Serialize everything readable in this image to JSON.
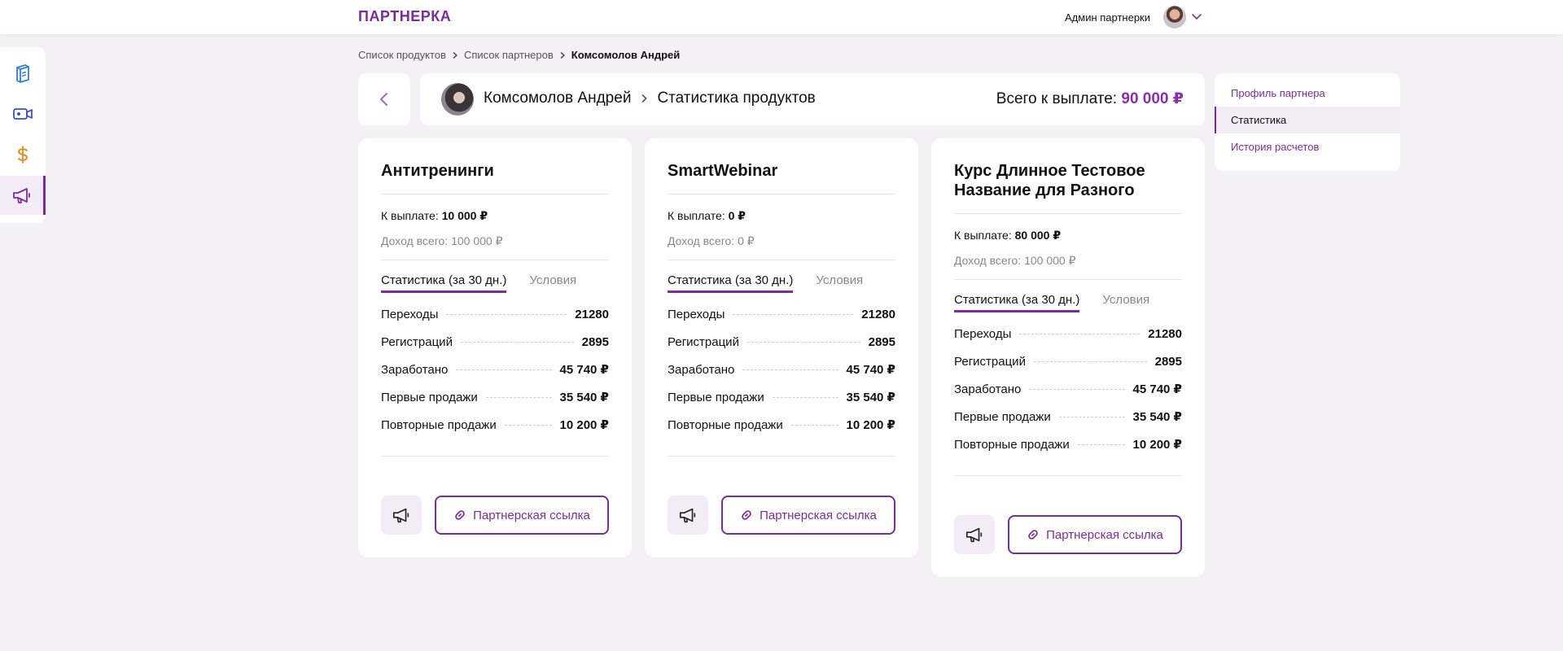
{
  "colors": {
    "accent": "#7a2c9c",
    "accent_bright": "#8a2fae",
    "background": "#f3f1f5"
  },
  "header": {
    "logo": "ПАРТНЕРКА",
    "user_name": "Админ партнерки",
    "avatar_icon": "user-avatar",
    "menu_icon": "chevron-down-icon"
  },
  "rail": {
    "items": [
      {
        "icon": "book-icon"
      },
      {
        "icon": "video-camera-icon"
      },
      {
        "icon": "dollar-icon"
      },
      {
        "icon": "megaphone-icon",
        "active": true
      }
    ]
  },
  "breadcrumb": {
    "items": [
      "Список продуктов",
      "Список партнеров"
    ],
    "current": "Комсомолов Андрей"
  },
  "page": {
    "partner_name": "Комсомолов Андрей",
    "section": "Статистика продуктов",
    "total_label": "Всего к выплате:",
    "total_value": "90 000 ₽"
  },
  "side_nav": {
    "items": [
      {
        "label": "Профиль партнера"
      },
      {
        "label": "Статистика",
        "active": true
      },
      {
        "label": "История расчетов"
      }
    ]
  },
  "cards": [
    {
      "title": "Антитренинги",
      "payout_label": "К выплате:",
      "payout_value": "10 000 ₽",
      "income": "Доход всего: 100 000 ₽",
      "tab_stats": "Статистика (за 30 дн.)",
      "tab_terms": "Условия",
      "stats": [
        {
          "label": "Переходы",
          "value": "21280"
        },
        {
          "label": "Регистраций",
          "value": "2895"
        },
        {
          "label": "Заработано",
          "value": "45 740 ₽"
        },
        {
          "label": "Первые продажи",
          "value": "35 540 ₽"
        },
        {
          "label": "Повторные продажи",
          "value": "10 200 ₽"
        }
      ],
      "link_label": "Партнерская ссылка"
    },
    {
      "title": "SmartWebinar",
      "payout_label": "К выплате:",
      "payout_value": "0 ₽",
      "income": "Доход всего: 0 ₽",
      "tab_stats": "Статистика (за 30 дн.)",
      "tab_terms": "Условия",
      "stats": [
        {
          "label": "Переходы",
          "value": "21280"
        },
        {
          "label": "Регистраций",
          "value": "2895"
        },
        {
          "label": "Заработано",
          "value": "45 740 ₽"
        },
        {
          "label": "Первые продажи",
          "value": "35 540 ₽"
        },
        {
          "label": "Повторные продажи",
          "value": "10 200 ₽"
        }
      ],
      "link_label": "Партнерская ссылка"
    },
    {
      "title": "Курс Длинное Тестовое Название для Разного",
      "payout_label": "К выплате:",
      "payout_value": "80 000 ₽",
      "income": "Доход всего: 100 000 ₽",
      "tab_stats": "Статистика (за 30 дн.)",
      "tab_terms": "Условия",
      "stats": [
        {
          "label": "Переходы",
          "value": "21280"
        },
        {
          "label": "Регистраций",
          "value": "2895"
        },
        {
          "label": "Заработано",
          "value": "45 740 ₽"
        },
        {
          "label": "Первые продажи",
          "value": "35 540 ₽"
        },
        {
          "label": "Повторные продажи",
          "value": "10 200 ₽"
        }
      ],
      "link_label": "Партнерская ссылка"
    }
  ]
}
